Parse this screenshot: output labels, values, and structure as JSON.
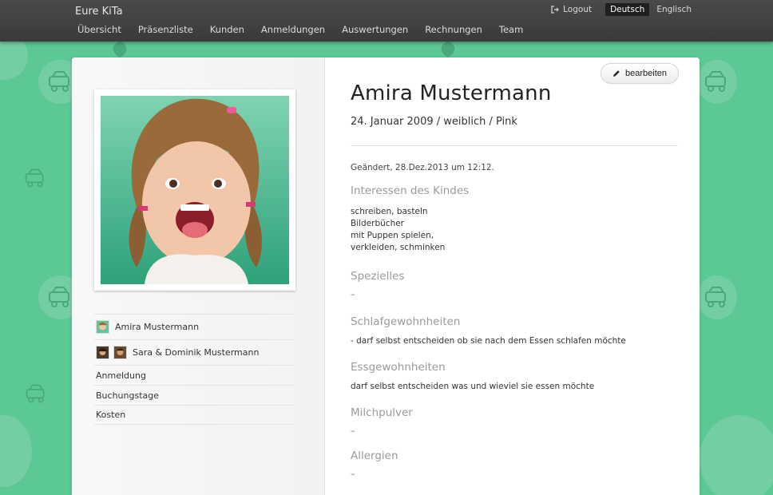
{
  "colors": {
    "background": "#5cc894",
    "topbar": "#3f3f3f",
    "active_lang": "#1f1f1f"
  },
  "header": {
    "brand": "Eure KiTa",
    "nav": [
      "Übersicht",
      "Präsenzliste",
      "Kunden",
      "Anmeldungen",
      "Auswertungen",
      "Rechnungen",
      "Team"
    ],
    "logout_label": "Logout",
    "logout_icon": "logout-icon",
    "languages": [
      {
        "label": "Deutsch",
        "active": true
      },
      {
        "label": "Englisch",
        "active": false
      }
    ]
  },
  "sidebar": {
    "photo_alt": "child-photo",
    "items": [
      {
        "label": "Amira Mustermann"
      },
      {
        "label": "Sara & Dominik Mustermann"
      },
      {
        "label": "Anmeldung"
      },
      {
        "label": "Buchungstage"
      },
      {
        "label": "Kosten"
      }
    ]
  },
  "profile": {
    "edit_label": "bearbeiten",
    "edit_icon": "pencil-icon",
    "name": "Amira Mustermann",
    "meta": "24. Januar 2009 / weiblich / Pink",
    "changed": "Geändert, 28.Dez.2013 um 12:12.",
    "sections": [
      {
        "title": "Interessen des Kindes",
        "lines": [
          "schreiben, basteln",
          "Bilderbücher",
          "mit Puppen spielen,",
          "verkleiden, schminken"
        ]
      },
      {
        "title": "Spezielles",
        "lines": [
          "–"
        ]
      },
      {
        "title": "Schlafgewohnheiten",
        "lines": [
          "- darf selbst entscheiden ob sie nach dem Essen schlafen möchte"
        ]
      },
      {
        "title": "Essgewohnheiten",
        "lines": [
          "darf selbst entscheiden was und wieviel sie essen möchte"
        ]
      },
      {
        "title": "Milchpulver",
        "lines": [
          "–"
        ]
      },
      {
        "title": "Allergien",
        "lines": [
          "–"
        ]
      }
    ]
  }
}
